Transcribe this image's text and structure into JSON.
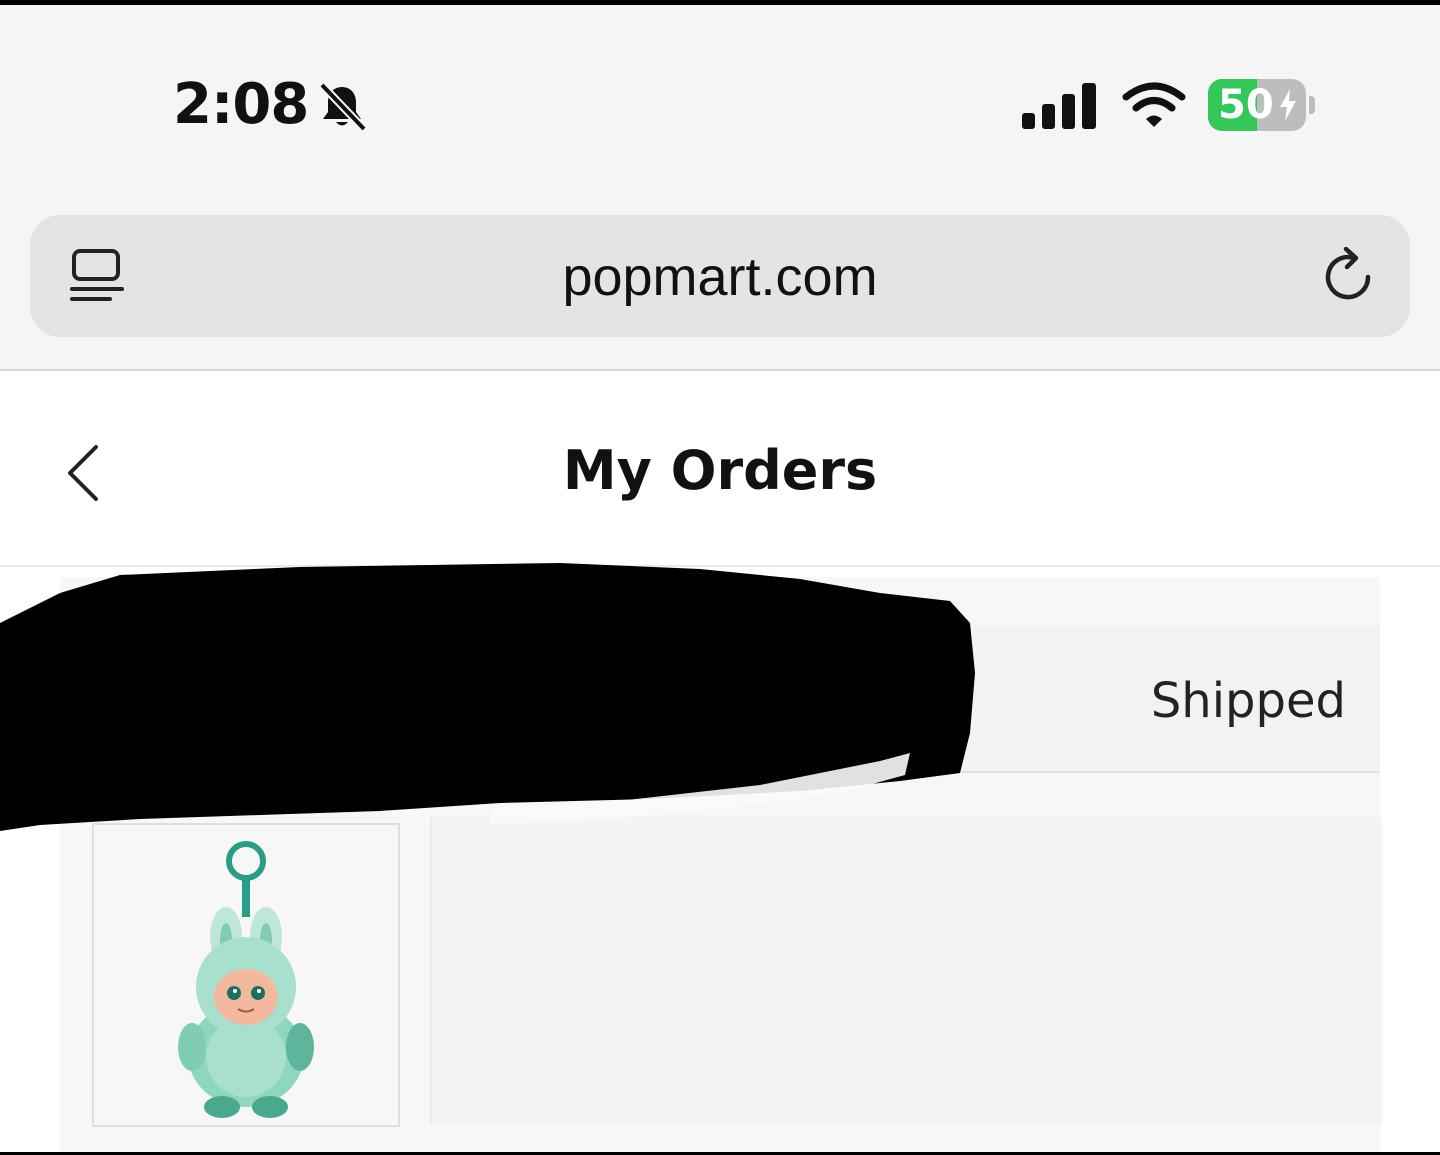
{
  "status_bar": {
    "time": "2:08",
    "battery_percent": "50",
    "battery_level": 0.5,
    "silent_icon": "bell-slash-icon",
    "signal_icon": "cellular-signal-icon",
    "wifi_icon": "wifi-icon",
    "battery_charging": true
  },
  "browser": {
    "url": "popmart.com",
    "reader_icon": "reader-mode-icon",
    "reload_icon": "reload-icon"
  },
  "page": {
    "title": "My Orders",
    "back_icon": "chevron-left-icon"
  },
  "order": {
    "status": "Shipped",
    "product_image": "green-bunny-plush-keychain"
  },
  "colors": {
    "battery_green": "#34c759",
    "background": "#f5f5f5",
    "text": "#111111"
  }
}
